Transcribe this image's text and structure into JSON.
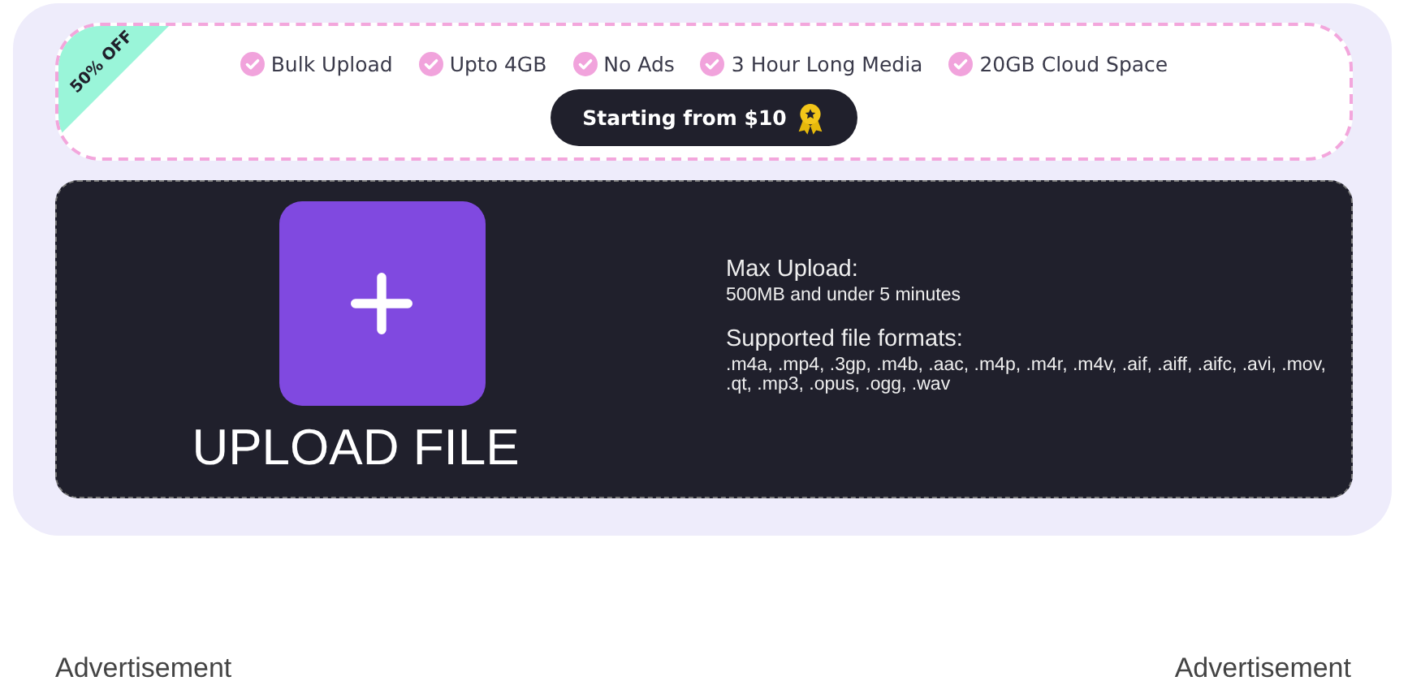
{
  "promo": {
    "ribbon": "50% OFF",
    "features": [
      "Bulk Upload",
      "Upto 4GB",
      "No Ads",
      "3 Hour Long Media",
      "20GB Cloud Space"
    ],
    "cta": "Starting from $10"
  },
  "upload": {
    "label": "UPLOAD FILE",
    "max_title": "Max Upload:",
    "max_text": "500MB and under 5 minutes",
    "formats_title": "Supported file formats:",
    "formats_text": ".m4a, .mp4, .3gp, .m4b, .aac, .m4p, .m4r, .m4v, .aif, .aiff, .aifc, .avi, .mov, .qt, .mp3, .opus, .ogg, .wav"
  },
  "ads": [
    "Advertisement",
    "Advertisement"
  ]
}
